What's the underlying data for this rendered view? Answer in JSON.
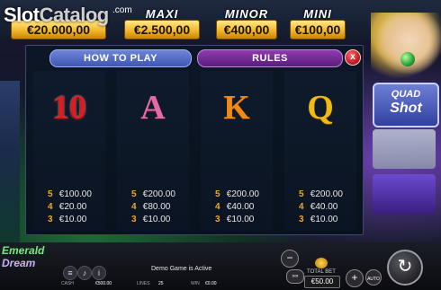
{
  "watermark": {
    "logo_text": "Slot",
    "logo_text2": "Catalog",
    "logo_suffix": ".com"
  },
  "jackpots": [
    {
      "name": "",
      "value": "€20.000,00"
    },
    {
      "name": "MAXI",
      "value": "€2.500,00"
    },
    {
      "name": "MINOR",
      "value": "€400,00"
    },
    {
      "name": "MINI",
      "value": "€100,00"
    }
  ],
  "game_logo": {
    "line1": "QUAD",
    "line2": "Shot"
  },
  "modal": {
    "tab_how_to_play": "HOW TO PLAY",
    "tab_rules": "RULES",
    "close_label": "x",
    "symbols": [
      {
        "symbol": "10",
        "pays": [
          {
            "count": "5",
            "amount": "€100.00"
          },
          {
            "count": "4",
            "amount": "€20.00"
          },
          {
            "count": "3",
            "amount": "€10.00"
          }
        ]
      },
      {
        "symbol": "A",
        "pays": [
          {
            "count": "5",
            "amount": "€200.00"
          },
          {
            "count": "4",
            "amount": "€80.00"
          },
          {
            "count": "3",
            "amount": "€10.00"
          }
        ]
      },
      {
        "symbol": "K",
        "pays": [
          {
            "count": "5",
            "amount": "€200.00"
          },
          {
            "count": "4",
            "amount": "€40.00"
          },
          {
            "count": "3",
            "amount": "€10.00"
          }
        ]
      },
      {
        "symbol": "Q",
        "pays": [
          {
            "count": "5",
            "amount": "€200.00"
          },
          {
            "count": "4",
            "amount": "€40.00"
          },
          {
            "count": "3",
            "amount": "€10.00"
          }
        ]
      }
    ]
  },
  "bottom_bar": {
    "game_logo_line1": "Emerald",
    "game_logo_line2": "Dream",
    "demo_text": "Demo Game is Active",
    "cash_label": "CASH",
    "cash_value": "€500.00",
    "lines_label": "LINES",
    "lines_value": "25",
    "win_label": "WIN",
    "win_value": "€0.00",
    "total_bet_label": "TOTAL BET",
    "total_bet_value": "€50.00",
    "minus_label": "−",
    "plus_label": "+",
    "speed_label": "»»",
    "auto_label": "AUTO",
    "spin_label": "↻"
  }
}
